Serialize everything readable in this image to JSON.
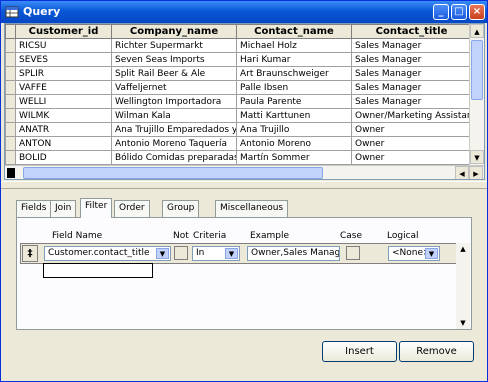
{
  "window": {
    "title": "Query"
  },
  "grid": {
    "columns": [
      "Customer_id",
      "Company_name",
      "Contact_name",
      "Contact_title"
    ],
    "rows": [
      [
        "RICSU",
        "Richter Supermarkt",
        "Michael Holz",
        "Sales Manager"
      ],
      [
        "SEVES",
        "Seven Seas Imports",
        "Hari Kumar",
        "Sales Manager"
      ],
      [
        "SPLIR",
        "Split Rail Beer & Ale",
        "Art Braunschweiger",
        "Sales Manager"
      ],
      [
        "VAFFE",
        "Vaffeljernet",
        "Palle Ibsen",
        "Sales Manager"
      ],
      [
        "WELLI",
        "Wellington Importadora",
        "Paula Parente",
        "Sales Manager"
      ],
      [
        "WILMK",
        "Wilman Kala",
        "Matti Karttunen",
        "Owner/Marketing Assistant"
      ],
      [
        "ANATR",
        "Ana Trujillo Emparedados y helados",
        "Ana Trujillo",
        "Owner"
      ],
      [
        "ANTON",
        "Antonio Moreno Taquería",
        "Antonio Moreno",
        "Owner"
      ],
      [
        "BOLID",
        "Bólido Comidas preparadas",
        "Martín Sommer",
        "Owner"
      ]
    ]
  },
  "tabs": [
    "Fields",
    "Join",
    "Filter",
    "Order By",
    "Group By",
    "Miscellaneous"
  ],
  "active_tab": "Filter",
  "filter": {
    "headers": {
      "field_name": "Field Name",
      "not": "Not",
      "criteria": "Criteria",
      "example": "Example",
      "case": "Case",
      "logical": "Logical"
    },
    "row": {
      "field_name": "Customer.contact_title",
      "criteria": "In",
      "example": "Owner,Sales Manag",
      "logical": "<None>"
    }
  },
  "buttons": {
    "insert": "Insert",
    "remove": "Remove"
  }
}
